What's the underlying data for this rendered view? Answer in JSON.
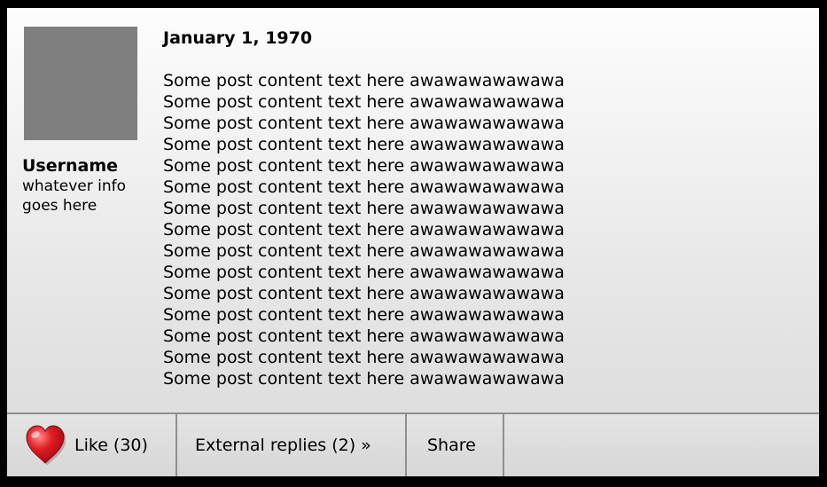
{
  "post": {
    "date": "January 1, 1970",
    "lines": [
      "Some post content text here awawawawawawa",
      "Some post content text here awawawawawawa",
      "Some post content text here awawawawawawa",
      "Some post content text here awawawawawawa",
      "Some post content text here awawawawawawa",
      "Some post content text here awawawawawawa",
      "Some post content text here awawawawawawa",
      "Some post content text here awawawawawawa",
      "Some post content text here awawawawawawa",
      "Some post content text here awawawawawawa",
      "Some post content text here awawawawawawa",
      "Some post content text here awawawawawawa",
      "Some post content text here awawawawawawa",
      "Some post content text here awawawawawawa",
      "Some post content text here awawawawawawa"
    ]
  },
  "author": {
    "username": "Username",
    "info": "whatever info goes here"
  },
  "actions": {
    "like_label": "Like (30)",
    "like_icon": "heart-icon",
    "like_color": "#e31b23",
    "replies_label": "External replies (2) »",
    "share_label": "Share"
  },
  "colors": {
    "frame": "#000000",
    "avatar": "#7f7f7f",
    "divider": "#8f8f8f"
  }
}
